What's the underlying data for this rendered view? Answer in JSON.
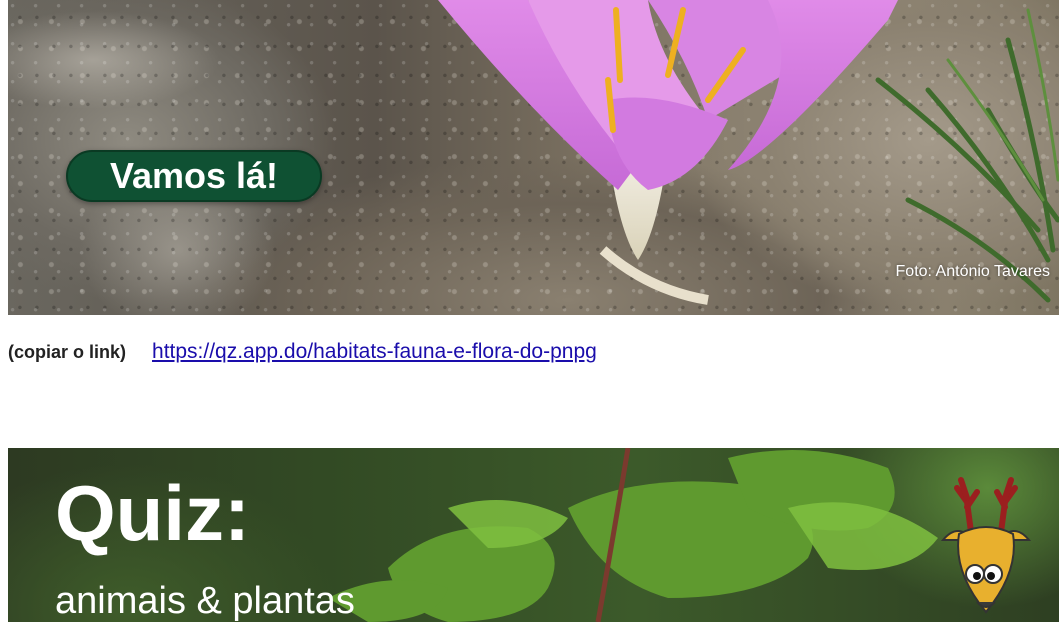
{
  "top_banner": {
    "button_label": "Vamos lá!",
    "photo_credit": "Foto: António Tavares"
  },
  "link_row": {
    "copy_label": "(copiar o link)",
    "url": "https://qz.app.do/habitats-fauna-e-flora-do-pnpg"
  },
  "bottom_banner": {
    "title": "Quiz:",
    "subtitle": "animais & plantas"
  },
  "colors": {
    "button_bg": "#0f5133",
    "link": "#1a0dab",
    "flower_petal": "#d77fe0",
    "stamen": "#f0b020"
  },
  "icons": {
    "mascot": "deer-mascot-icon"
  }
}
